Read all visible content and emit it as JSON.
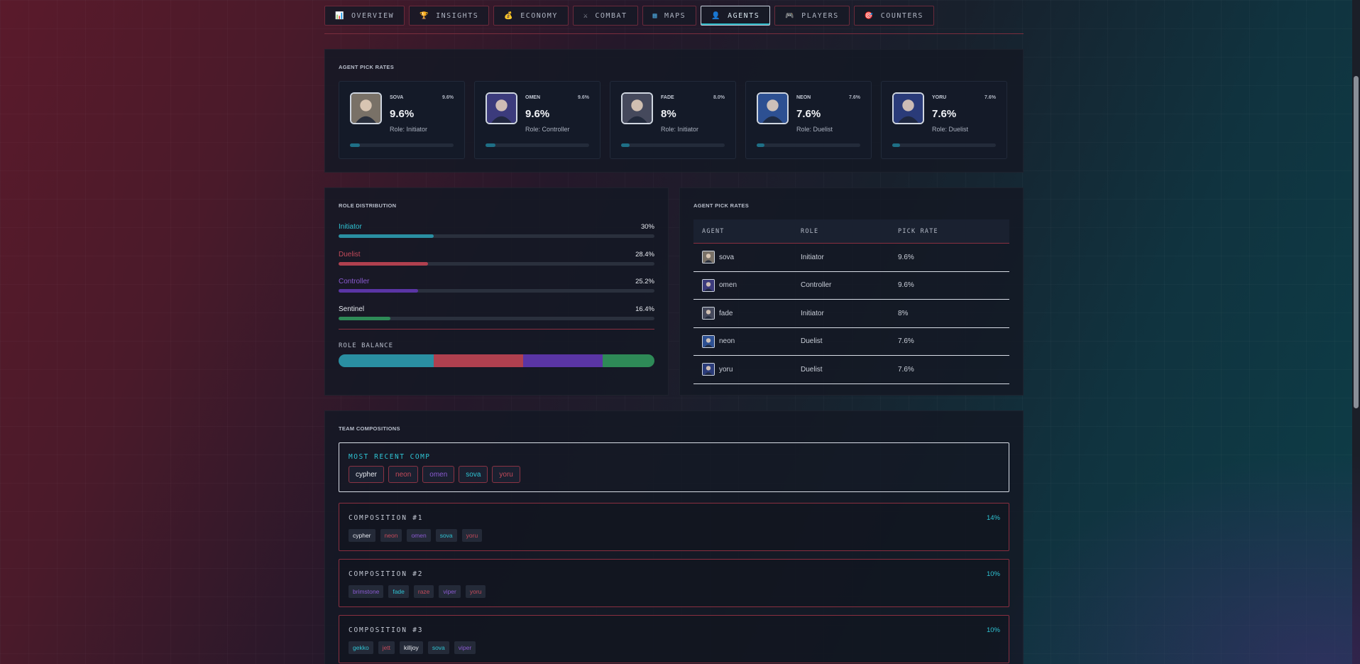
{
  "tabs": [
    {
      "label": "OVERVIEW",
      "icon": "📊",
      "icon_name": "chart-icon"
    },
    {
      "label": "INSIGHTS",
      "icon": "🏆",
      "icon_name": "trophy-icon"
    },
    {
      "label": "ECONOMY",
      "icon": "💰",
      "icon_name": "money-bag-icon"
    },
    {
      "label": "COMBAT",
      "icon": "⚔",
      "icon_name": "swords-icon"
    },
    {
      "label": "MAPS",
      "icon": "▦",
      "icon_name": "map-icon"
    },
    {
      "label": "AGENTS",
      "icon": "👤",
      "icon_name": "agent-icon",
      "active": true
    },
    {
      "label": "PLAYERS",
      "icon": "🎮",
      "icon_name": "gamepad-icon"
    },
    {
      "label": "COUNTERS",
      "icon": "🎯",
      "icon_name": "target-icon"
    }
  ],
  "pick_rates_panel": {
    "title": "AGENT PICK RATES",
    "cards": [
      {
        "name": "SOVA",
        "corner": "9.6%",
        "rate": "9.6%",
        "role": "Role: Initiator",
        "fill": 0.096,
        "color": "#b9a27a"
      },
      {
        "name": "OMEN",
        "corner": "9.6%",
        "rate": "9.6%",
        "role": "Role: Controller",
        "fill": 0.096,
        "color": "#4b3fa0"
      },
      {
        "name": "FADE",
        "corner": "8.0%",
        "rate": "8%",
        "role": "Role: Initiator",
        "fill": 0.08,
        "color": "#5b5a66"
      },
      {
        "name": "NEON",
        "corner": "7.6%",
        "rate": "7.6%",
        "role": "Role: Duelist",
        "fill": 0.076,
        "color": "#2f66c8"
      },
      {
        "name": "YORU",
        "corner": "7.6%",
        "rate": "7.6%",
        "role": "Role: Duelist",
        "fill": 0.076,
        "color": "#2a3f9a"
      }
    ]
  },
  "role_distribution": {
    "title": "ROLE DISTRIBUTION",
    "roles": [
      {
        "name": "Initiator",
        "pct": "30%",
        "value": 30,
        "color": "#2a8fa2",
        "label_color": "#2fc3d3"
      },
      {
        "name": "Duelist",
        "pct": "28.4%",
        "value": 28.4,
        "color": "#b0404f",
        "label_color": "#c44a5a"
      },
      {
        "name": "Controller",
        "pct": "25.2%",
        "value": 25.2,
        "color": "#5a35a5",
        "label_color": "#8a5ad0"
      },
      {
        "name": "Sentinel",
        "pct": "16.4%",
        "value": 16.4,
        "color": "#2e8a57",
        "label_color": "#e6e9ef"
      }
    ],
    "balance_label": "ROLE BALANCE"
  },
  "pick_table": {
    "title": "AGENT PICK RATES",
    "headers": [
      "AGENT",
      "ROLE",
      "PICK RATE"
    ],
    "rows": [
      {
        "agent": "sova",
        "role": "Initiator",
        "rate": "9.6%",
        "color": "#b9a27a"
      },
      {
        "agent": "omen",
        "role": "Controller",
        "rate": "9.6%",
        "color": "#4b3fa0"
      },
      {
        "agent": "fade",
        "role": "Initiator",
        "rate": "8%",
        "color": "#5b5a66"
      },
      {
        "agent": "neon",
        "role": "Duelist",
        "rate": "7.6%",
        "color": "#2f66c8"
      },
      {
        "agent": "yoru",
        "role": "Duelist",
        "rate": "7.6%",
        "color": "#2a3f9a"
      }
    ]
  },
  "team_comps": {
    "title": "TEAM COMPOSITIONS",
    "recent_label": "MOST RECENT COMP",
    "recent": [
      {
        "name": "cypher",
        "color": "#e6e9ef"
      },
      {
        "name": "neon",
        "color": "#c44a5a"
      },
      {
        "name": "omen",
        "color": "#8a5ad0"
      },
      {
        "name": "sova",
        "color": "#2fc3d3"
      },
      {
        "name": "yoru",
        "color": "#c44a5a"
      }
    ],
    "comps": [
      {
        "label": "COMPOSITION #1",
        "pct": "14%",
        "agents": [
          {
            "name": "cypher",
            "color": "#e6e9ef"
          },
          {
            "name": "neon",
            "color": "#c44a5a"
          },
          {
            "name": "omen",
            "color": "#8a5ad0"
          },
          {
            "name": "sova",
            "color": "#2fc3d3"
          },
          {
            "name": "yoru",
            "color": "#c44a5a"
          }
        ]
      },
      {
        "label": "COMPOSITION #2",
        "pct": "10%",
        "agents": [
          {
            "name": "brimstone",
            "color": "#8a5ad0"
          },
          {
            "name": "fade",
            "color": "#2fc3d3"
          },
          {
            "name": "raze",
            "color": "#c44a5a"
          },
          {
            "name": "viper",
            "color": "#8a5ad0"
          },
          {
            "name": "yoru",
            "color": "#c44a5a"
          }
        ]
      },
      {
        "label": "COMPOSITION #3",
        "pct": "10%",
        "agents": [
          {
            "name": "gekko",
            "color": "#2fc3d3"
          },
          {
            "name": "jett",
            "color": "#c44a5a"
          },
          {
            "name": "killjoy",
            "color": "#e6e9ef"
          },
          {
            "name": "sova",
            "color": "#2fc3d3"
          },
          {
            "name": "viper",
            "color": "#8a5ad0"
          }
        ]
      }
    ]
  }
}
